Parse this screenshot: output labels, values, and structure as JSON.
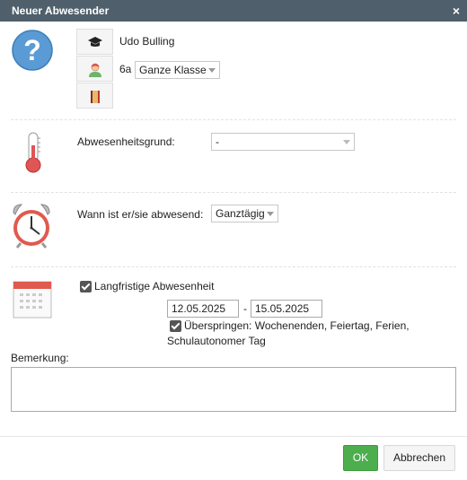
{
  "window": {
    "title": "Neuer Abwesender",
    "close_icon": "×"
  },
  "person": {
    "name": "Udo Bulling",
    "class_name": "6a",
    "group_select": "Ganze Klasse"
  },
  "reason": {
    "label": "Abwesenheitsgrund:",
    "value": "-"
  },
  "when": {
    "label": "Wann ist er/sie abwesend:",
    "value": "Ganztägig"
  },
  "longterm": {
    "label": "Langfristige Abwesenheit",
    "from": "12.05.2025",
    "separator": "-",
    "to": "15.05.2025",
    "skip_label_line1": "Überspringen: Wochenenden, Feiertag, Ferien,",
    "skip_label_line2": "Schulautonomer Tag"
  },
  "remark": {
    "label": "Bemerkung:",
    "value": ""
  },
  "buttons": {
    "ok": "OK",
    "cancel": "Abbrechen"
  },
  "colors": {
    "titlebar": "#4f5f6b",
    "ok_button": "#4cae4c",
    "help_icon": "#5b9bd5",
    "thermometer": "#e05555",
    "clock": "#e05a4f"
  }
}
